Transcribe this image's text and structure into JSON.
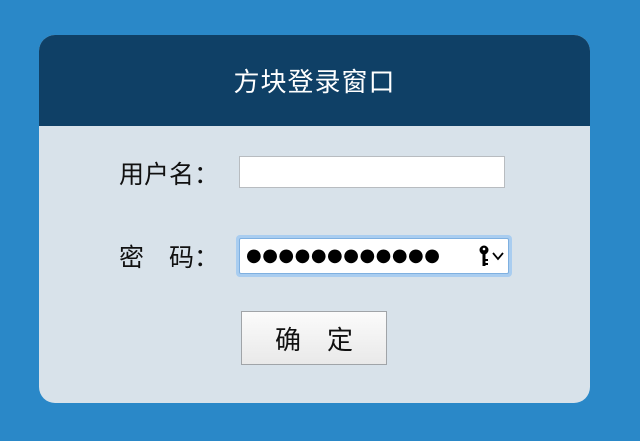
{
  "window": {
    "title": "方块登录窗口"
  },
  "form": {
    "username_label": "用户名：",
    "username_value": "",
    "password_label": "密　码：",
    "password_mask": "●●●●●●●●●●●●",
    "submit_label": "确　定"
  },
  "icons": {
    "password_key": "key-icon",
    "password_dropdown": "chevron-down-icon"
  },
  "colors": {
    "background": "#2a88c8",
    "header": "#0f4066",
    "panel": "#d8e2ea"
  }
}
